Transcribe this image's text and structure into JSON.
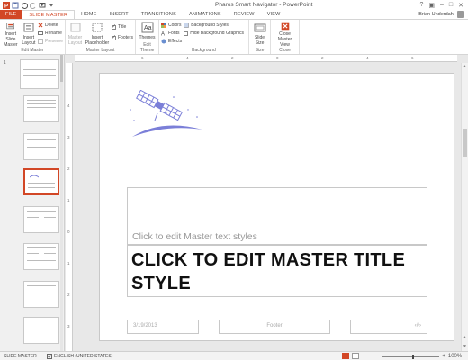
{
  "window": {
    "title": "Pharos Smart Navigator - PowerPoint",
    "controls": [
      "?",
      "▣",
      "–",
      "□",
      "✕"
    ]
  },
  "tabs": [
    "FILE",
    "SLIDE MASTER",
    "HOME",
    "INSERT",
    "TRANSITIONS",
    "ANIMATIONS",
    "REVIEW",
    "VIEW"
  ],
  "user": {
    "name": "Brian Underdahl"
  },
  "ribbon": {
    "edit_master": {
      "label": "Edit Master",
      "insert_slide_master": "Insert Slide Master",
      "insert_layout": "Insert Layout",
      "delete": "Delete",
      "rename": "Rename",
      "preserve": "Preserve"
    },
    "master_layout": {
      "label": "Master Layout",
      "master_layout_btn": "Master Layout",
      "insert_placeholder": "Insert Placeholder",
      "title": "Title",
      "footers": "Footers"
    },
    "edit_theme": {
      "label": "Edit Theme",
      "themes": "Themes"
    },
    "background": {
      "label": "Background",
      "colors": "Colors",
      "fonts": "Fonts",
      "effects": "Effects",
      "background_styles": "Background Styles",
      "hide_background_graphics": "Hide Background Graphics"
    },
    "size": {
      "label": "Size",
      "slide_size": "Slide Size"
    },
    "close": {
      "label": "Close",
      "close_master_view": "Close Master View"
    }
  },
  "thumbnails": [
    {
      "number": "1"
    },
    {
      "number": ""
    },
    {
      "number": ""
    },
    {
      "number": ""
    },
    {
      "number": ""
    },
    {
      "number": ""
    },
    {
      "number": ""
    },
    {
      "number": ""
    }
  ],
  "ruler": {
    "h_ticks": [
      "6",
      "4",
      "2",
      "0",
      "2",
      "4",
      "6"
    ],
    "v_ticks": [
      "4",
      "3",
      "2",
      "1",
      "0",
      "1",
      "2",
      "3",
      "4"
    ]
  },
  "slide": {
    "subtitle_placeholder": "Click to edit Master text styles",
    "title_placeholder": "CLICK TO EDIT MASTER TITLE STYLE",
    "date": "3/19/2013",
    "footer": "Footer",
    "page_number": "‹#›"
  },
  "status": {
    "mode": "SLIDE MASTER",
    "language": "ENGLISH (UNITED STATES)",
    "zoom": "100%"
  },
  "colors": {
    "accent": "#d24726",
    "satellite": "#7b7fd8"
  }
}
